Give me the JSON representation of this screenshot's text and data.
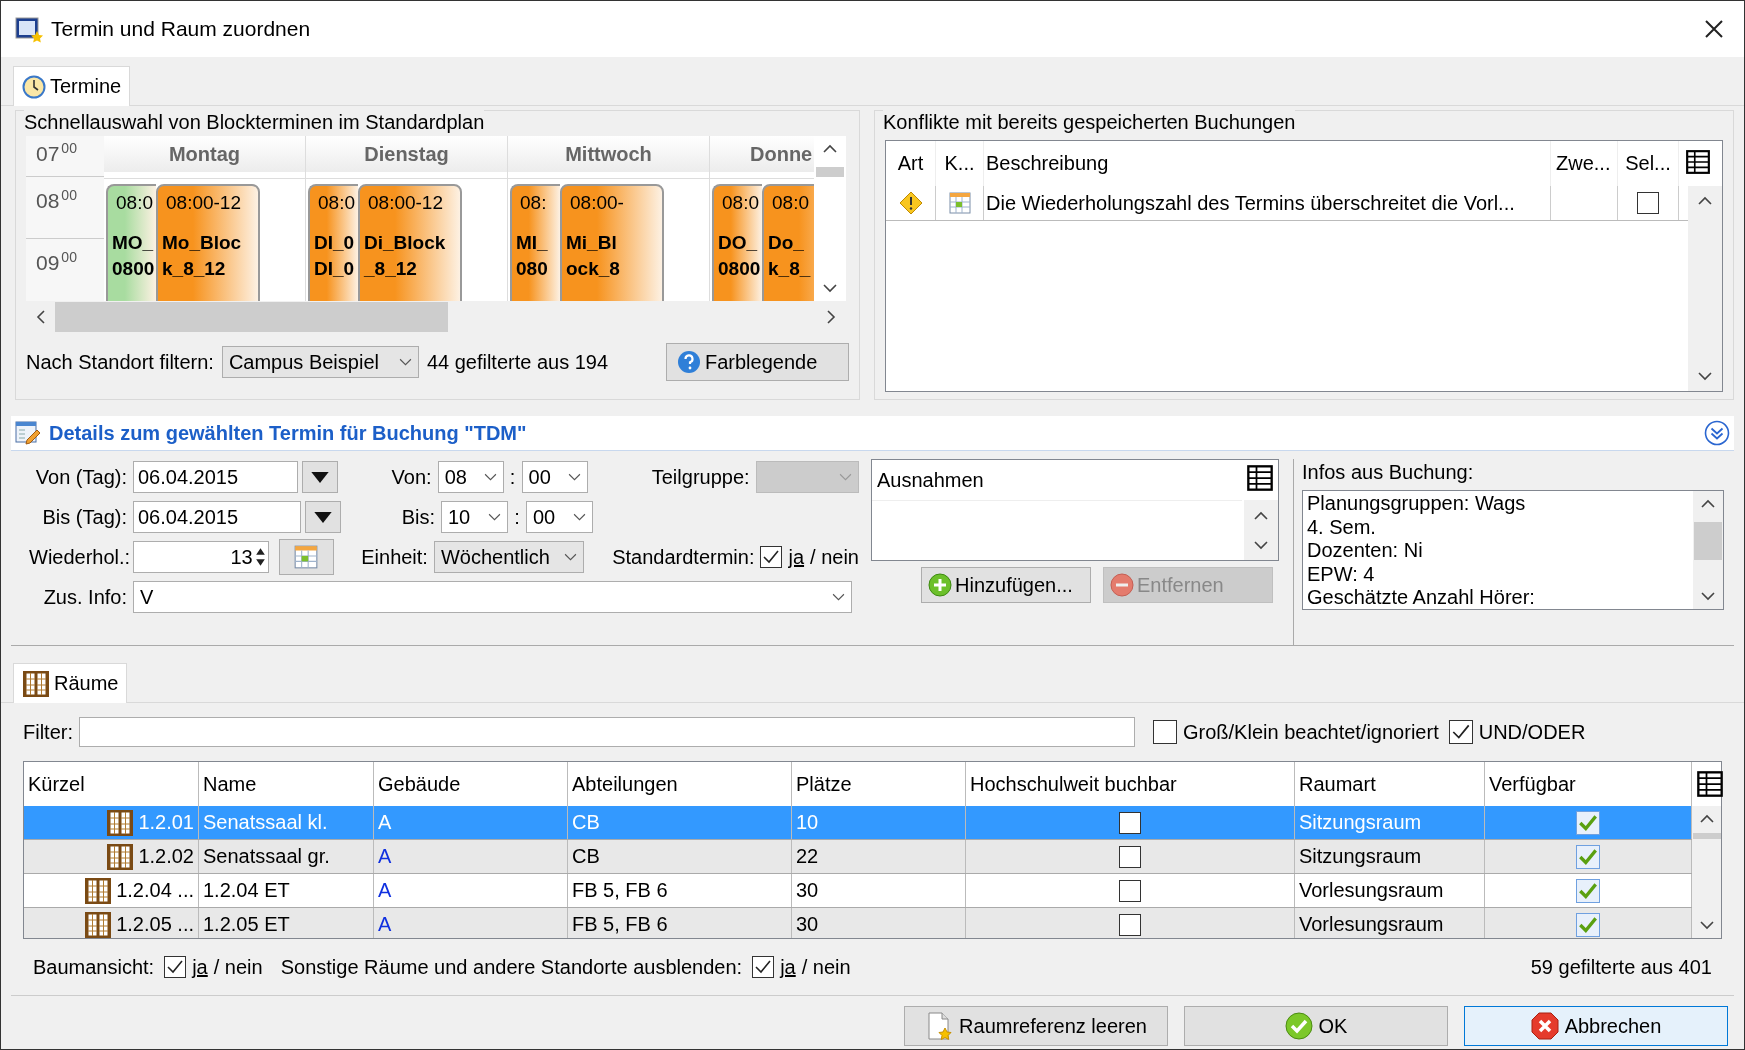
{
  "window": {
    "title": "Termin und Raum zuordnen"
  },
  "top_tabs": [
    {
      "label": "Termine",
      "selected": true
    }
  ],
  "quick_select": {
    "title": "Schnellauswahl von Blockterminen im Standardplan",
    "hours": [
      {
        "hour": "07",
        "minutes": "00"
      },
      {
        "hour": "08",
        "minutes": "00"
      },
      {
        "hour": "09",
        "minutes": "00"
      }
    ],
    "days": [
      {
        "label": "Montag",
        "events": [
          {
            "time": "08:0",
            "lines": [
              "MO_",
              "0800"
            ],
            "color": "#a8dca0"
          },
          {
            "time": "08:00-12",
            "lines": [
              "Mo_Bloc",
              "k_8_12"
            ],
            "color": "#f7931e"
          }
        ]
      },
      {
        "label": "Dienstag",
        "events": [
          {
            "time": "08:0",
            "lines": [
              "DI_0",
              "DI_0"
            ],
            "color": "#f7931e"
          },
          {
            "time": "08:00-12",
            "lines": [
              "Di_Block",
              "_8_12"
            ],
            "color": "#f7931e"
          }
        ]
      },
      {
        "label": "Mittwoch",
        "events": [
          {
            "time": "08:",
            "lines": [
              "MI_",
              "080"
            ],
            "color": "#f7931e"
          },
          {
            "time": "08:00-",
            "lines": [
              "Mi_Bl",
              "ock_8"
            ],
            "color": "#f7931e"
          }
        ]
      },
      {
        "label": "Donne",
        "events": [
          {
            "time": "08:0",
            "lines": [
              "DO_",
              "0800"
            ],
            "color": "#f7931e"
          },
          {
            "time": "08:0",
            "lines": [
              "Do_",
              "k_8_"
            ],
            "color": "#f7931e"
          }
        ]
      }
    ],
    "filter_label": "Nach Standort filtern:",
    "filter_value": "Campus Beispiel",
    "count": "44 gefilterte aus 194",
    "legend_button": "Farblegende"
  },
  "conflicts": {
    "title": "Konflikte mit bereits gespeicherten Buchungen",
    "columns": [
      "Art",
      "K...",
      "Beschreibung",
      "Zwe...",
      "Sel..."
    ],
    "rows": [
      {
        "kind": "warning",
        "description": "Die Wiederholungszahl des Termins überschreitet die Vorl...",
        "selected": false
      }
    ]
  },
  "details": {
    "title": "Details zum gewählten Termin für Buchung \"TDM\"",
    "from_day_label": "Von (Tag):",
    "from_day": "06.04.2015",
    "to_day_label": "Bis (Tag):",
    "to_day": "06.04.2015",
    "repeat_label": "Wiederhol.:",
    "repeat": "13",
    "from_label": "Von:",
    "from_hour": "08",
    "from_min": "00",
    "to_label": "Bis:",
    "to_hour": "10",
    "to_min": "00",
    "colon": ":",
    "unit_label": "Einheit:",
    "unit": "Wöchentlich",
    "subgroup_label": "Teilgruppe:",
    "subgroup_disabled": true,
    "standard_label": "Standardtermin:",
    "standard_checked": true,
    "yes": "ja",
    "no": "/ nein",
    "info_label": "Zus. Info:",
    "info": "V",
    "exceptions_header": "Ausnahmen",
    "add_button": {
      "label": "Hinzufügen...",
      "disabled": false
    },
    "remove_button": {
      "label": "Entfernen",
      "disabled": true
    },
    "booking_info_label": "Infos aus Buchung:",
    "booking_info": [
      "Planungsgruppen: Wags",
      "4. Sem.",
      "Dozenten: Ni",
      "EPW: 4",
      "Geschätzte Anzahl Hörer:"
    ]
  },
  "rooms": {
    "tabs": [
      {
        "label": "Räume",
        "selected": true
      }
    ],
    "filter_label": "Filter:",
    "case_checked": false,
    "case_label": "Groß/Klein beachtet/ignoriert",
    "andor_checked": true,
    "andor_label": "UND/ODER",
    "columns": [
      "Kürzel",
      "Name",
      "Gebäude",
      "Abteilungen",
      "Plätze",
      "Hochschulweit buchbar",
      "Raumart",
      "Verfügbar"
    ],
    "rows": [
      {
        "code": "1.2.01",
        "name": "Senatssaal kl.",
        "building": "A",
        "departments": "CB",
        "seats": "10",
        "campus_wide": false,
        "type": "Sitzungsraum",
        "available": true,
        "selected": true
      },
      {
        "code": "1.2.02",
        "name": "Senatssaal gr.",
        "building": "A",
        "departments": "CB",
        "seats": "22",
        "campus_wide": false,
        "type": "Sitzungsraum",
        "available": true,
        "selected": false
      },
      {
        "code": "1.2.04 ...",
        "name": "1.2.04 ET",
        "building": "A",
        "departments": "FB 5, FB 6",
        "seats": "30",
        "campus_wide": false,
        "type": "Vorlesungsraum",
        "available": true,
        "selected": false
      },
      {
        "code": "1.2.05 ...",
        "name": "1.2.05 ET",
        "building": "A",
        "departments": "FB 5, FB 6",
        "seats": "30",
        "campus_wide": false,
        "type": "Vorlesungsraum",
        "available": true,
        "selected": false
      }
    ],
    "tree_label": "Baumansicht:",
    "tree_checked": true,
    "tree_yes": "ja",
    "tree_no": "/ nein",
    "hide_label": "Sonstige Räume und andere Standorte ausblenden:",
    "hide_checked": true,
    "hide_yes": "ja",
    "hide_no": "/ nein",
    "count": "59 gefilterte aus 401"
  },
  "buttons": [
    {
      "kind": "clear",
      "label": "Raumreferenz leeren"
    },
    {
      "kind": "ok",
      "label": "OK"
    },
    {
      "kind": "cancel",
      "label": "Abbrechen"
    }
  ]
}
